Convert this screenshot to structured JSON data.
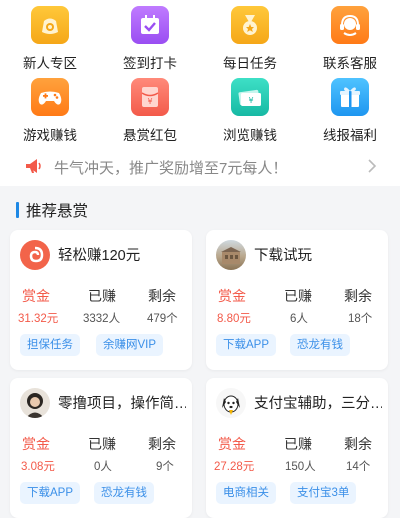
{
  "grid": [
    {
      "label": "新人专区",
      "icon": "coin-pouch-icon"
    },
    {
      "label": "签到打卡",
      "icon": "calendar-check-icon"
    },
    {
      "label": "每日任务",
      "icon": "medal-icon"
    },
    {
      "label": "联系客服",
      "icon": "headset-icon"
    },
    {
      "label": "游戏赚钱",
      "icon": "gamepad-icon"
    },
    {
      "label": "悬赏红包",
      "icon": "red-envelope-icon"
    },
    {
      "label": "浏览赚钱",
      "icon": "banknote-icon"
    },
    {
      "label": "线报福利",
      "icon": "gift-icon"
    }
  ],
  "notice": {
    "text": "牛气冲天，推广奖励增至7元每人！",
    "icon": "megaphone-icon"
  },
  "section": {
    "title": "推荐悬赏"
  },
  "stats_labels": {
    "reward": "赏金",
    "earned": "已赚",
    "remaining": "剩余"
  },
  "cards": [
    {
      "title": "轻松赚120元",
      "reward": "31.32元",
      "earned": "3332人",
      "remaining": "479个",
      "tags": [
        "担保任务",
        "余赚网VIP"
      ],
      "avatar": "spiral-logo-avatar"
    },
    {
      "title": "下载试玩",
      "reward": "8.80元",
      "earned": "6人",
      "remaining": "18个",
      "tags": [
        "下载APP",
        "恐龙有钱"
      ],
      "avatar": "building-photo-avatar"
    },
    {
      "title": "零撸项目，操作简…",
      "reward": "3.08元",
      "earned": "0人",
      "remaining": "9个",
      "tags": [
        "下载APP",
        "恐龙有钱"
      ],
      "avatar": "portrait-photo-avatar"
    },
    {
      "title": "支付宝辅助，三分…",
      "reward": "27.28元",
      "earned": "150人",
      "remaining": "14个",
      "tags": [
        "电商相关",
        "支付宝3单"
      ],
      "avatar": "dog-cartoon-avatar"
    }
  ],
  "colors": {
    "accent_blue": "#1e88e5",
    "reward_red": "#f35a4a",
    "tag_bg": "#eaf4ff",
    "tag_text": "#3a8fe8"
  }
}
